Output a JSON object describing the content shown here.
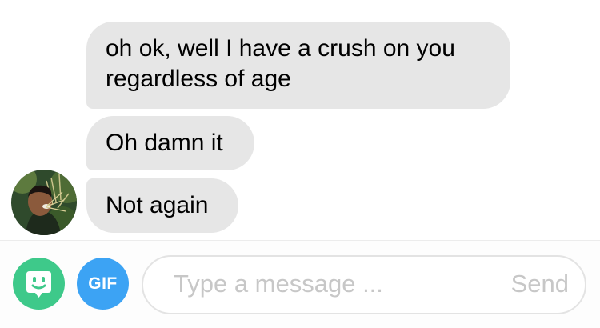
{
  "messages": [
    {
      "text": "oh ok, well I have a crush on you\nregardless of age"
    },
    {
      "text": "Oh damn it"
    },
    {
      "text": "Not again"
    }
  ],
  "composer": {
    "sticker_icon": "sticker-face-icon",
    "gif_label": "GIF",
    "placeholder": "Type a message ...",
    "send_label": "Send"
  },
  "colors": {
    "bubble": "#e6e6e6",
    "sticker_button": "#3ec98a",
    "gif_button": "#3ca3f4",
    "placeholder_text": "#c7c7c7"
  }
}
